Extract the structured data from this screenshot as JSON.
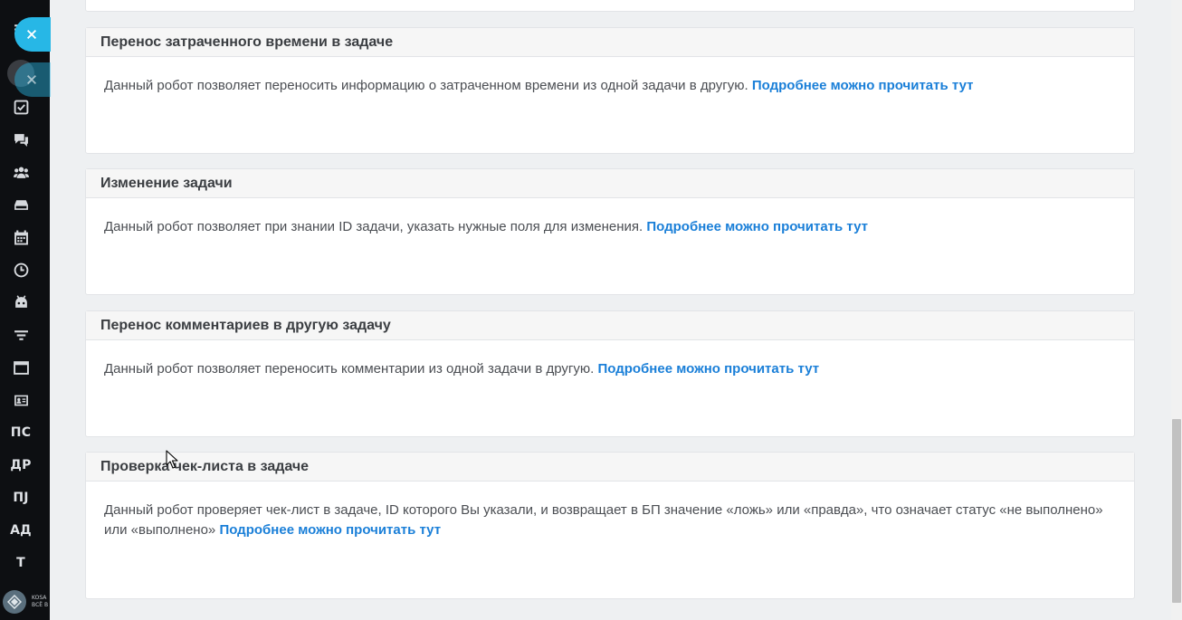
{
  "sidebar": {
    "text_items": [
      "ПС",
      "ДР",
      "ПJ",
      "АД",
      "Т"
    ],
    "logo_text_line1": "KOSA",
    "logo_text_line2": "ВСЁ В"
  },
  "cards": [
    {
      "title": "Перенос затраченного времени в задаче",
      "description": "Данный робот позволяет переносить информацию о затраченном времени из одной задачи в другую.",
      "link": "Подробнее можно прочитать тут"
    },
    {
      "title": "Изменение задачи",
      "description": "Данный робот позволяет при знании ID задачи, указать нужные поля для изменения.",
      "link": "Подробнее можно прочитать тут"
    },
    {
      "title": "Перенос комментариев в другую задачу",
      "description": "Данный робот позволяет переносить комментарии из одной задачи в другую.",
      "link": "Подробнее можно прочитать тут"
    },
    {
      "title": "Проверка чек-листа в задаче",
      "description": "Данный робот проверяет чек-лист в задаче, ID которого Вы указали, и возвращает в БП значение «ложь» или «правда», что означает статус «не выполнено» или «выполнено»",
      "link": "Подробнее можно прочитать тут"
    }
  ],
  "colors": {
    "accent": "#27b7e6",
    "link": "#1a7fd8",
    "sidebar_bg": "#0d0f12",
    "page_bg": "#eef0f2"
  }
}
